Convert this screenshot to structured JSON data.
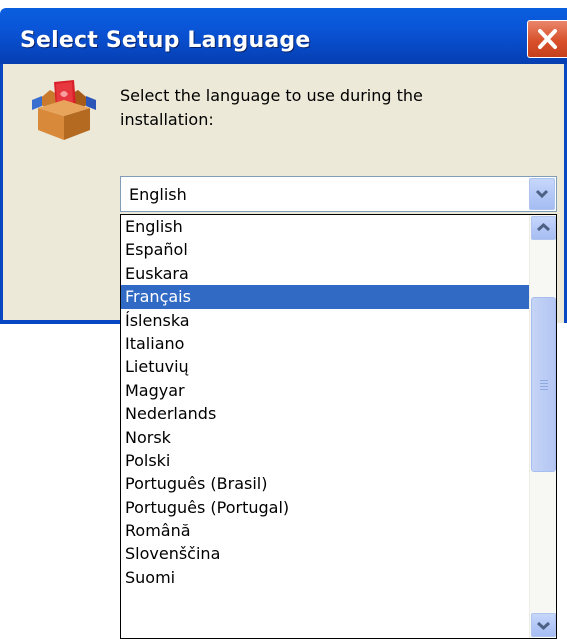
{
  "window": {
    "title": "Select Setup Language"
  },
  "dialog": {
    "prompt": "Select the language to use during the installation:",
    "icons": {
      "setup": "setup-box-icon",
      "close": "close-icon",
      "dropdown_arrow": "chevron-down-icon",
      "scroll_up": "chevron-up-icon",
      "scroll_down": "chevron-down-icon",
      "scroll_grip": "grip-icon"
    }
  },
  "language_select": {
    "selected_value": "English",
    "options": [
      "English",
      "Español",
      "Euskara",
      "Français",
      "Íslenska",
      "Italiano",
      "Lietuvių",
      "Magyar",
      "Nederlands",
      "Norsk",
      "Polski",
      "Português (Brasil)",
      "Português (Portugal)",
      "Română",
      "Slovenščina",
      "Suomi"
    ],
    "highlighted_index": 3
  },
  "colors": {
    "titlebar": "#0a55d8",
    "client_bg": "#ece9d8",
    "highlight": "#316ac5",
    "close_button": "#d8512b"
  }
}
